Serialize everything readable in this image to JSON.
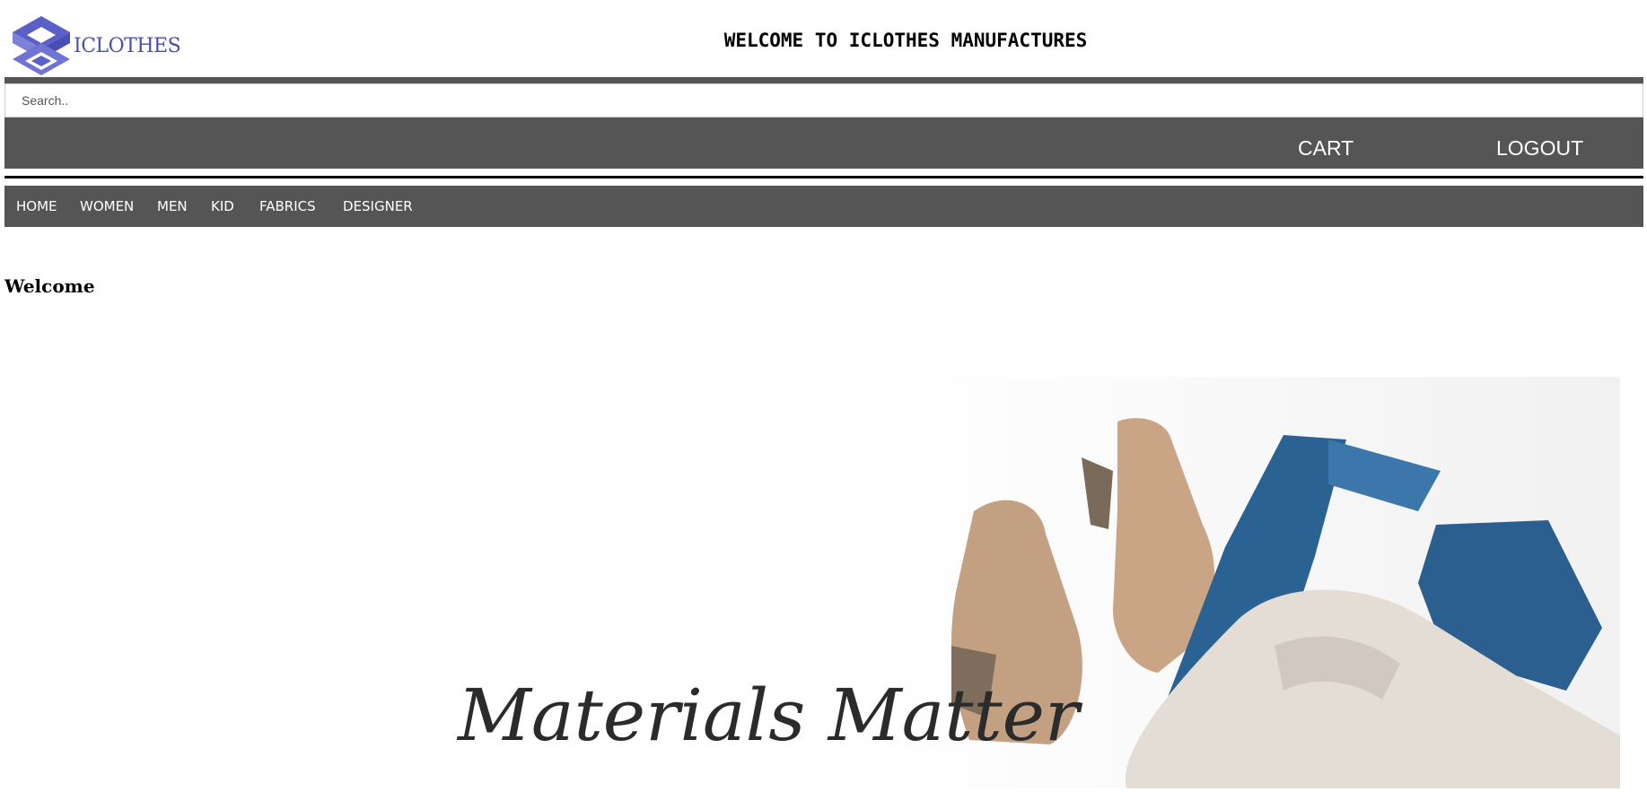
{
  "header": {
    "logo_text": "ICLOTHES",
    "title": "WELCOME TO ICLOTHES MANUFACTURES"
  },
  "search": {
    "placeholder": "Search.."
  },
  "account": {
    "cart_label": "CART",
    "logout_label": "LOGOUT"
  },
  "nav": {
    "items": [
      {
        "label": "HOME"
      },
      {
        "label": "WOMEN"
      },
      {
        "label": "MEN"
      },
      {
        "label": "KID"
      },
      {
        "label": "FABRICS"
      },
      {
        "label": "DESIGNER"
      }
    ]
  },
  "main": {
    "heading": "Welcome",
    "banner_text": "Materials Matter"
  },
  "colors": {
    "bar": "#555555",
    "logo": "#5a60c8",
    "denim": "#2a6294",
    "suede": "#c9a585"
  },
  "icons": {
    "logo": "nested-diamond-logo-icon"
  }
}
